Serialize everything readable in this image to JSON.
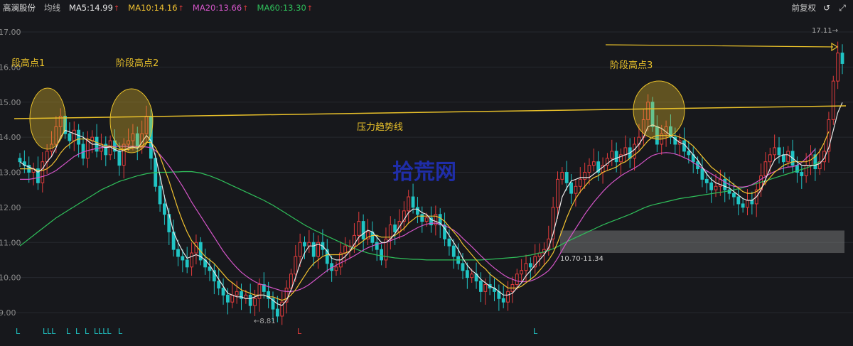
{
  "header": {
    "stock_name": "高澜股份",
    "avg_label": "均线",
    "ma_items": [
      {
        "label": "MA5:14.99",
        "color": "#e8e8e8"
      },
      {
        "label": "MA10:14.16",
        "color": "#f2c230"
      },
      {
        "label": "MA20:13.66",
        "color": "#d455c8"
      },
      {
        "label": "MA60:13.30",
        "color": "#2fbf5a"
      }
    ],
    "adjust_label": "前复权",
    "refresh_icon": "refresh-icon",
    "expand_icon": "expand-icon"
  },
  "colors": {
    "up": "#e23c3c",
    "down": "#20c4c4",
    "ma5": "#e8e8e8",
    "ma10": "#f2c230",
    "ma20": "#d455c8",
    "ma60": "#2fbf5a",
    "annotation": "#e8c02a",
    "watermark": "#2233cc"
  },
  "chart_data": {
    "type": "candlestick",
    "y_tick_labels": [
      "17.00",
      "16.00",
      "15.00",
      "14.00",
      "13.00",
      "12.00",
      "11.00",
      "10.00",
      "9.00"
    ],
    "ylim": [
      8.7,
      17.2
    ],
    "closes": [
      13.3,
      13.2,
      13.0,
      13.1,
      12.7,
      13.3,
      13.6,
      13.8,
      14.3,
      14.6,
      14.1,
      13.9,
      14.2,
      13.8,
      13.4,
      13.9,
      14.0,
      13.6,
      13.8,
      13.5,
      13.9,
      13.6,
      13.2,
      13.8,
      13.9,
      14.1,
      13.7,
      14.1,
      14.6,
      13.4,
      12.6,
      12.1,
      11.8,
      11.3,
      10.8,
      10.6,
      10.5,
      10.3,
      10.7,
      11.0,
      10.5,
      10.3,
      10.2,
      9.9,
      9.7,
      9.5,
      9.3,
      9.5,
      9.6,
      9.4,
      9.5,
      9.2,
      9.4,
      9.8,
      9.6,
      9.4,
      9.1,
      8.9,
      9.3,
      9.7,
      10.1,
      10.6,
      11.0,
      10.9,
      11.0,
      10.6,
      11.0,
      10.8,
      10.4,
      10.2,
      10.3,
      10.7,
      10.9,
      10.9,
      11.2,
      11.6,
      11.1,
      11.3,
      11.0,
      10.8,
      10.5,
      11.1,
      11.5,
      11.3,
      11.6,
      11.9,
      12.3,
      12.0,
      11.8,
      11.6,
      11.7,
      11.5,
      11.8,
      11.5,
      11.1,
      10.9,
      10.6,
      10.4,
      10.2,
      10.0,
      10.1,
      9.9,
      9.6,
      9.8,
      9.7,
      9.6,
      9.4,
      9.3,
      9.6,
      9.8,
      10.1,
      10.2,
      10.4,
      10.3,
      10.6,
      10.7,
      10.8,
      11.1,
      12.0,
      12.8,
      13.0,
      12.7,
      12.4,
      12.6,
      12.8,
      13.0,
      13.2,
      13.3,
      13.0,
      13.2,
      13.4,
      13.6,
      13.3,
      13.5,
      13.7,
      13.4,
      13.8,
      14.0,
      14.5,
      15.0,
      14.3,
      13.8,
      14.1,
      14.3,
      14.0,
      13.8,
      13.9,
      13.6,
      13.5,
      13.3,
      13.1,
      12.8,
      12.7,
      12.5,
      12.6,
      12.8,
      12.5,
      12.4,
      12.3,
      12.1,
      12.0,
      12.2,
      12.1,
      12.5,
      12.9,
      13.3,
      13.5,
      13.7,
      13.5,
      13.3,
      13.6,
      13.2,
      13.0,
      12.9,
      13.2,
      13.5,
      13.1,
      13.3,
      13.6,
      14.5,
      15.6,
      16.4,
      16.1
    ],
    "mid_ann": {
      "low_text": "←8.81",
      "zone_text": "10.70-11.34"
    },
    "ma5": [
      13.3,
      13.2,
      13.15,
      13.1,
      13.0,
      13.1,
      13.3,
      13.45,
      13.7,
      14.0,
      14.2,
      14.15,
      14.1,
      14.05,
      14.0,
      13.9,
      13.8,
      13.8,
      13.75,
      13.7,
      13.72,
      13.65,
      13.6,
      13.62,
      13.7,
      13.72,
      13.68,
      13.85,
      14.05,
      13.9,
      13.45,
      12.9,
      12.3,
      11.8,
      11.3,
      11.0,
      10.75,
      10.55,
      10.6,
      10.65,
      10.6,
      10.5,
      10.35,
      10.15,
      9.95,
      9.75,
      9.55,
      9.5,
      9.45,
      9.45,
      9.4,
      9.4,
      9.45,
      9.5,
      9.5,
      9.45,
      9.35,
      9.25,
      9.2,
      9.35,
      9.65,
      10.0,
      10.4,
      10.7,
      10.9,
      10.9,
      10.95,
      10.9,
      10.75,
      10.55,
      10.5,
      10.5,
      10.6,
      10.75,
      10.95,
      11.15,
      11.25,
      11.35,
      11.3,
      11.15,
      11.0,
      11.0,
      11.1,
      11.25,
      11.45,
      11.65,
      11.85,
      11.95,
      11.95,
      11.85,
      11.8,
      11.65,
      11.6,
      11.55,
      11.4,
      11.2,
      11.0,
      10.8,
      10.55,
      10.35,
      10.2,
      10.1,
      9.95,
      9.85,
      9.75,
      9.7,
      9.6,
      9.5,
      9.5,
      9.55,
      9.7,
      9.85,
      10.05,
      10.2,
      10.35,
      10.5,
      10.65,
      10.85,
      11.25,
      11.75,
      12.3,
      12.55,
      12.75,
      12.8,
      12.85,
      12.85,
      12.85,
      12.95,
      13.05,
      13.15,
      13.25,
      13.35,
      13.4,
      13.45,
      13.5,
      13.55,
      13.65,
      13.8,
      14.0,
      14.3,
      14.35,
      14.3,
      14.25,
      14.15,
      14.05,
      13.95,
      13.85,
      13.8,
      13.65,
      13.5,
      13.35,
      13.15,
      12.95,
      12.8,
      12.7,
      12.65,
      12.6,
      12.55,
      12.45,
      12.35,
      12.25,
      12.2,
      12.2,
      12.3,
      12.5,
      12.8,
      13.1,
      13.35,
      13.45,
      13.5,
      13.5,
      13.4,
      13.3,
      13.2,
      13.2,
      13.2,
      13.2,
      13.25,
      13.4,
      13.7,
      14.2,
      14.7,
      14.99
    ],
    "ma10": [
      13.1,
      13.1,
      13.1,
      13.1,
      13.05,
      13.05,
      13.1,
      13.2,
      13.35,
      13.55,
      13.7,
      13.8,
      13.9,
      13.95,
      13.95,
      13.95,
      13.9,
      13.85,
      13.8,
      13.75,
      13.75,
      13.7,
      13.65,
      13.65,
      13.65,
      13.7,
      13.7,
      13.75,
      13.85,
      13.85,
      13.7,
      13.45,
      13.1,
      12.75,
      12.35,
      11.95,
      11.6,
      11.3,
      11.05,
      10.9,
      10.75,
      10.6,
      10.5,
      10.4,
      10.25,
      10.1,
      9.95,
      9.85,
      9.75,
      9.65,
      9.6,
      9.55,
      9.5,
      9.5,
      9.5,
      9.45,
      9.45,
      9.4,
      9.35,
      9.4,
      9.5,
      9.65,
      9.85,
      10.05,
      10.25,
      10.4,
      10.5,
      10.6,
      10.65,
      10.65,
      10.65,
      10.65,
      10.7,
      10.75,
      10.85,
      10.95,
      11.05,
      11.15,
      11.2,
      11.2,
      11.15,
      11.15,
      11.15,
      11.2,
      11.3,
      11.4,
      11.55,
      11.65,
      11.75,
      11.75,
      11.75,
      11.75,
      11.75,
      11.7,
      11.6,
      11.45,
      11.3,
      11.15,
      10.95,
      10.8,
      10.65,
      10.5,
      10.35,
      10.25,
      10.1,
      10.0,
      9.9,
      9.8,
      9.7,
      9.7,
      9.7,
      9.75,
      9.85,
      9.95,
      10.05,
      10.2,
      10.35,
      10.5,
      10.7,
      11.0,
      11.35,
      11.7,
      12.0,
      12.25,
      12.45,
      12.6,
      12.75,
      12.85,
      12.9,
      13.0,
      13.05,
      13.1,
      13.15,
      13.25,
      13.3,
      13.4,
      13.5,
      13.6,
      13.75,
      13.9,
      14.0,
      14.05,
      14.05,
      14.05,
      14.05,
      14.05,
      14.0,
      13.95,
      13.85,
      13.75,
      13.6,
      13.45,
      13.3,
      13.15,
      13.05,
      12.95,
      12.85,
      12.75,
      12.65,
      12.55,
      12.45,
      12.4,
      12.4,
      12.45,
      12.55,
      12.7,
      12.85,
      13.0,
      13.1,
      13.2,
      13.25,
      13.3,
      13.3,
      13.3,
      13.3,
      13.35,
      13.45,
      13.6,
      13.85,
      14.16
    ],
    "ma20": [
      12.8,
      12.8,
      12.8,
      12.82,
      12.85,
      12.88,
      12.92,
      12.98,
      13.05,
      13.15,
      13.25,
      13.35,
      13.45,
      13.52,
      13.58,
      13.62,
      13.65,
      13.68,
      13.7,
      13.72,
      13.73,
      13.74,
      13.74,
      13.74,
      13.74,
      13.74,
      13.73,
      13.73,
      13.72,
      13.7,
      13.62,
      13.5,
      13.35,
      13.18,
      13.0,
      12.8,
      12.6,
      12.38,
      12.15,
      11.95,
      11.75,
      11.55,
      11.35,
      11.15,
      10.95,
      10.75,
      10.58,
      10.42,
      10.28,
      10.15,
      10.05,
      9.96,
      9.88,
      9.82,
      9.78,
      9.74,
      9.7,
      9.66,
      9.62,
      9.6,
      9.6,
      9.62,
      9.66,
      9.72,
      9.8,
      9.9,
      10.0,
      10.1,
      10.2,
      10.28,
      10.35,
      10.42,
      10.48,
      10.55,
      10.62,
      10.7,
      10.78,
      10.85,
      10.9,
      10.95,
      10.98,
      11.0,
      11.05,
      11.1,
      11.15,
      11.2,
      11.28,
      11.35,
      11.42,
      11.48,
      11.52,
      11.55,
      11.55,
      11.52,
      11.48,
      11.42,
      11.35,
      11.25,
      11.12,
      11.0,
      10.88,
      10.75,
      10.62,
      10.5,
      10.38,
      10.27,
      10.17,
      10.08,
      10.0,
      9.95,
      9.9,
      9.88,
      9.88,
      9.9,
      9.95,
      10.02,
      10.1,
      10.2,
      10.35,
      10.55,
      10.78,
      11.0,
      11.2,
      11.4,
      11.6,
      11.8,
      11.98,
      12.15,
      12.3,
      12.45,
      12.58,
      12.7,
      12.8,
      12.9,
      12.98,
      13.05,
      13.12,
      13.2,
      13.3,
      13.4,
      13.48,
      13.52,
      13.55,
      13.56,
      13.55,
      13.52,
      13.48,
      13.42,
      13.36,
      13.28,
      13.2,
      13.12,
      13.04,
      12.96,
      12.88,
      12.8,
      12.72,
      12.65,
      12.6,
      12.58,
      12.58,
      12.6,
      12.65,
      12.72,
      12.8,
      12.88,
      12.96,
      13.02,
      13.08,
      13.12,
      13.15,
      13.16,
      13.2,
      13.28,
      13.4,
      13.52,
      13.66
    ],
    "ma60": [
      10.9,
      11.0,
      11.1,
      11.2,
      11.3,
      11.4,
      11.5,
      11.6,
      11.7,
      11.78,
      11.86,
      11.94,
      12.02,
      12.1,
      12.18,
      12.26,
      12.34,
      12.42,
      12.5,
      12.56,
      12.62,
      12.68,
      12.74,
      12.78,
      12.82,
      12.86,
      12.9,
      12.93,
      12.96,
      12.98,
      12.99,
      13.0,
      13.0,
      13.0,
      13.01,
      13.01,
      13.02,
      13.02,
      13.02,
      13.0,
      12.98,
      12.94,
      12.9,
      12.85,
      12.8,
      12.74,
      12.68,
      12.62,
      12.56,
      12.5,
      12.44,
      12.38,
      12.32,
      12.26,
      12.2,
      12.13,
      12.06,
      11.98,
      11.9,
      11.82,
      11.74,
      11.66,
      11.58,
      11.5,
      11.43,
      11.36,
      11.3,
      11.24,
      11.18,
      11.12,
      11.06,
      11.0,
      10.94,
      10.88,
      10.83,
      10.78,
      10.74,
      10.7,
      10.67,
      10.64,
      10.62,
      10.6,
      10.58,
      10.56,
      10.55,
      10.54,
      10.53,
      10.52,
      10.52,
      10.51,
      10.5,
      10.5,
      10.5,
      10.5,
      10.5,
      10.5,
      10.5,
      10.5,
      10.5,
      10.5,
      10.5,
      10.5,
      10.5,
      10.51,
      10.52,
      10.53,
      10.54,
      10.55,
      10.56,
      10.57,
      10.58,
      10.6,
      10.62,
      10.64,
      10.67,
      10.7,
      10.73,
      10.77,
      10.82,
      10.88,
      10.95,
      11.02,
      11.08,
      11.14,
      11.2,
      11.26,
      11.32,
      11.38,
      11.44,
      11.5,
      11.55,
      11.6,
      11.65,
      11.7,
      11.75,
      11.8,
      11.86,
      11.92,
      11.98,
      12.03,
      12.07,
      12.1,
      12.13,
      12.16,
      12.19,
      12.22,
      12.25,
      12.27,
      12.29,
      12.31,
      12.33,
      12.35,
      12.37,
      12.39,
      12.41,
      12.43,
      12.45,
      12.47,
      12.5,
      12.53,
      12.56,
      12.6,
      12.64,
      12.68,
      12.72,
      12.76,
      12.8,
      12.84,
      12.88,
      12.92,
      12.96,
      13.0,
      13.04,
      13.08,
      13.12,
      13.17,
      13.23,
      13.3
    ],
    "annotations": {
      "label1": "段高点1",
      "label2": "阶段高点2",
      "label3": "阶段高点3",
      "resistance": "压力趋势线",
      "watermark": "拾荒网",
      "high_value": "17.11→"
    },
    "bottom_markers": [
      "L",
      "LLL",
      "L",
      "L",
      "L",
      "LLLL",
      "L",
      "L",
      "L"
    ]
  }
}
